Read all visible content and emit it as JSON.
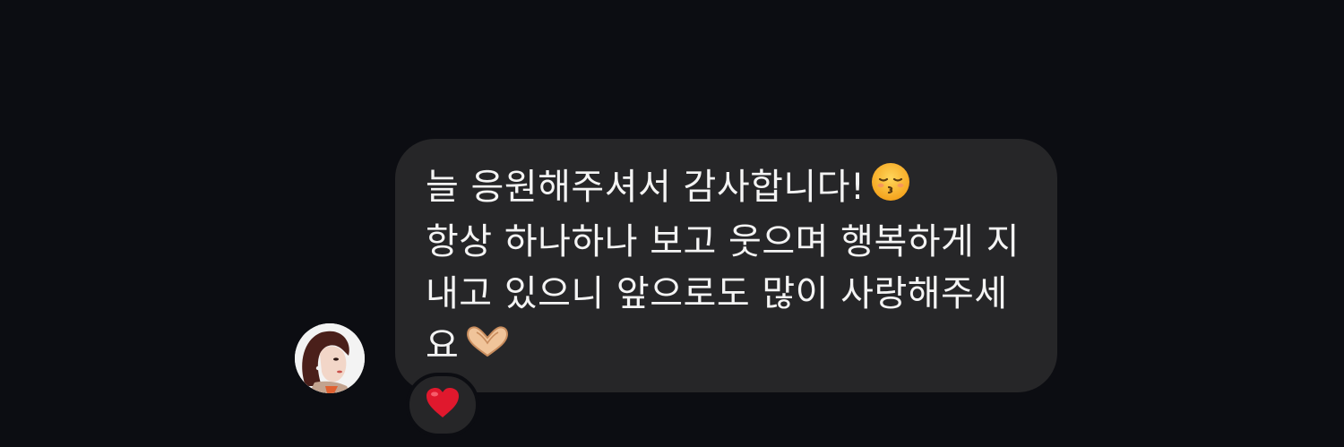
{
  "message": {
    "lines": [
      "늘 응원해주셔서 감사합니다!",
      "항상 하나하나 보고 웃으며 행복하게 지",
      "내고 있으니 앞으로도 많이 사랑해주세",
      "요"
    ],
    "emoji_line1": "kissing-face-with-closed-eyes-icon",
    "emoji_line4": "heart-hands-icon"
  },
  "reaction": {
    "emoji": "red-heart-icon",
    "color": "#e0182d"
  },
  "colors": {
    "background": "#0c0d12",
    "bubble": "#262628",
    "text": "#f4f4f4"
  }
}
